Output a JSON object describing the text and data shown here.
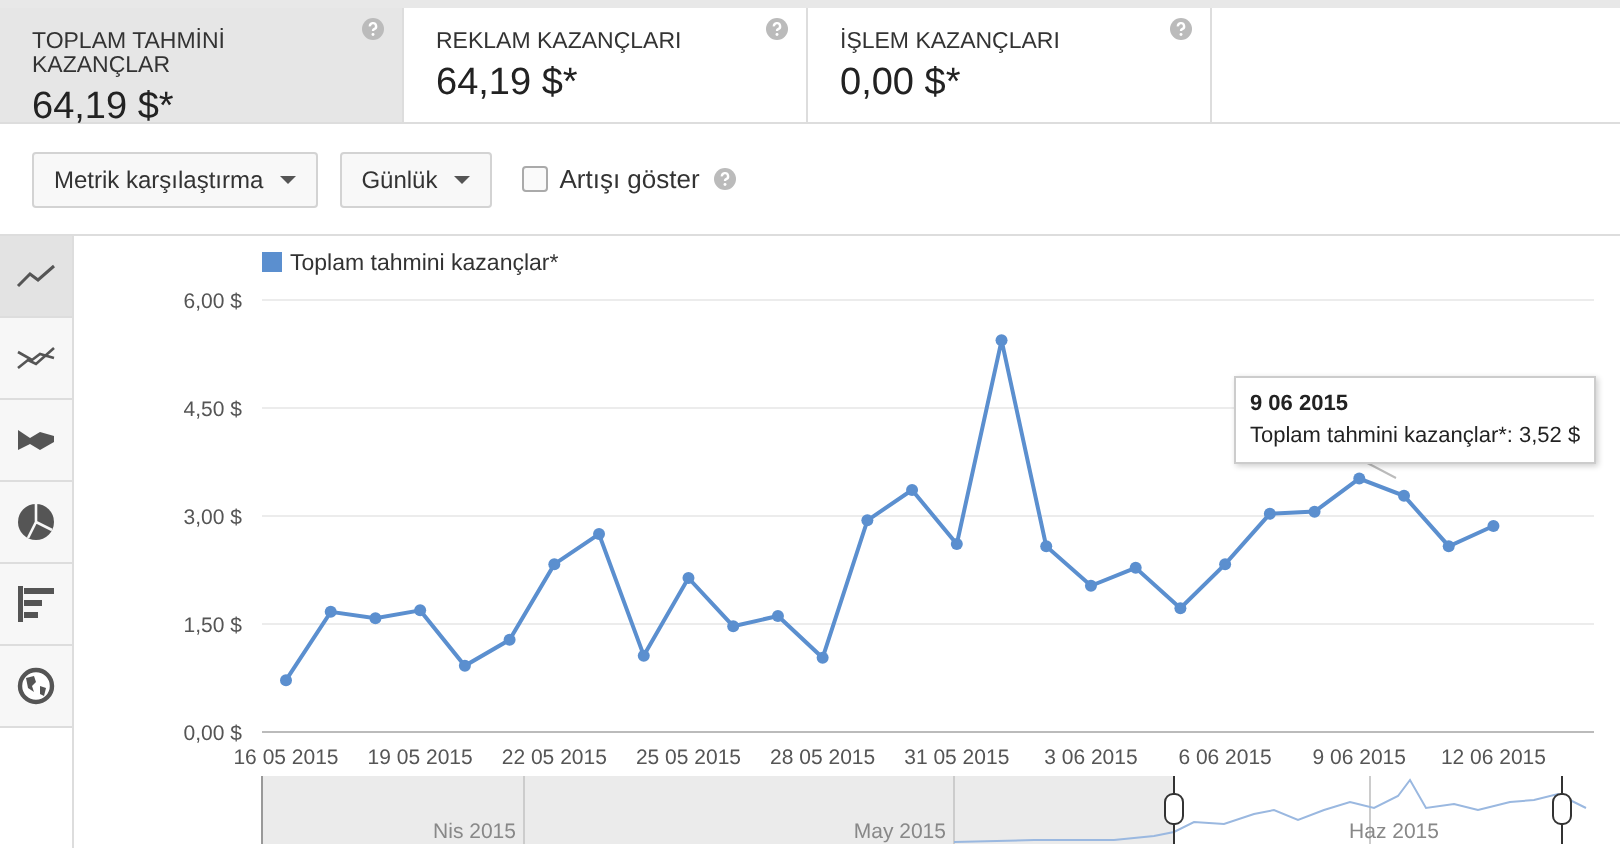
{
  "metrics": [
    {
      "label": "TOPLAM TAHMİNİ KAZANÇLAR",
      "value": "64,19 $*",
      "selected": true
    },
    {
      "label": "REKLAM KAZANÇLARI",
      "value": "64,19 $*",
      "selected": false
    },
    {
      "label": "İŞLEM KAZANÇLARI",
      "value": "0,00 $*",
      "selected": false
    }
  ],
  "toolbar": {
    "dropdowns": [
      "Metrik karşılaştırma",
      "Günlük"
    ],
    "checkbox": {
      "label": "Artışı göster",
      "checked": false
    }
  },
  "sidebar": {
    "items": [
      {
        "kind": "line",
        "selected": true
      },
      {
        "kind": "compare",
        "selected": false
      },
      {
        "kind": "area",
        "selected": false
      },
      {
        "kind": "pie",
        "selected": false
      },
      {
        "kind": "bar",
        "selected": false
      },
      {
        "kind": "map",
        "selected": false
      }
    ]
  },
  "chart": {
    "chart_data": {
      "type": "line",
      "categories": [
        "16 05 2015",
        null,
        null,
        "19 05 2015",
        null,
        null,
        "22 05 2015",
        null,
        null,
        "25 05 2015",
        null,
        null,
        "28 05 2015",
        null,
        null,
        "31 05 2015",
        null,
        null,
        "3 06 2015",
        null,
        null,
        "6 06 2015",
        null,
        null,
        "9 06 2015",
        null,
        null,
        "12 06 2015"
      ],
      "grid": true,
      "series": [
        {
          "name": "Toplam tahmini kazançlar*",
          "color": "#5b8fcf",
          "marker": true,
          "values": [
            0.72,
            1.67,
            1.58,
            1.69,
            0.92,
            1.28,
            2.33,
            2.75,
            1.06,
            2.14,
            1.47,
            1.61,
            1.03,
            2.94,
            3.36,
            2.61,
            5.44,
            2.58,
            2.03,
            2.28,
            1.72,
            2.33,
            3.03,
            3.06,
            3.52,
            3.28,
            2.58,
            2.86
          ]
        }
      ],
      "ylim": [
        0,
        6
      ],
      "yticks": [
        {
          "value": 0,
          "label": "0,00 $"
        },
        {
          "value": 1.5,
          "label": "1,50 $"
        },
        {
          "value": 3,
          "label": "3,00 $"
        },
        {
          "value": 4.5,
          "label": "4,50 $"
        },
        {
          "value": 6,
          "label": "6,00 $"
        }
      ]
    },
    "tooltip": {
      "title": "9 06 2015",
      "text": "Toplam tahmini kazançlar*: 3,52 $"
    }
  },
  "navigator": {
    "labels": [
      "Nis 2015",
      "May 2015",
      "Haz 2015"
    ]
  }
}
